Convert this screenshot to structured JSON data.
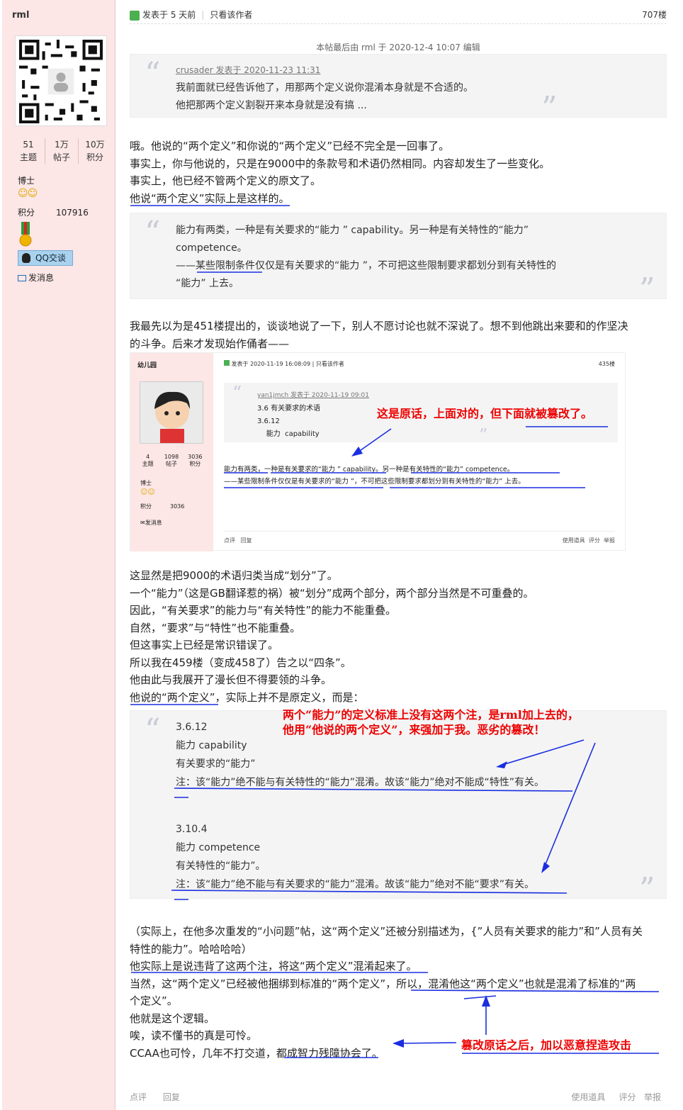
{
  "user": {
    "name": "rml",
    "stats": [
      {
        "num": "51",
        "label": "主题"
      },
      {
        "num": "1万",
        "label": "帖子"
      },
      {
        "num": "10万",
        "label": "积分"
      }
    ],
    "rank": "博士",
    "points_label": "积分",
    "points_value": "107916",
    "qq_label": "QQ交谈",
    "msg_label": "发消息"
  },
  "post": {
    "posted": "发表于 5 天前",
    "only_author": "只看该作者",
    "floor": "707楼",
    "edited": "本帖最后由 rml 于 2020-12-4 10:07 编辑"
  },
  "quote1": {
    "head": "crusader 发表于 2020-11-23 11:31",
    "lines": [
      "我前面就已经告诉他了，用那两个定义说你混淆本身就是不合适的。",
      "他把那两个定义割裂开来本身就是没有搞 ..."
    ]
  },
  "para1": [
    "哦。他说的“两个定义”和你说的“两个定义”已经不完全是一回事了。",
    "事实上，你与他说的，只是在9000中的条款号和术语仍然相同。内容却发生了一些变化。",
    "事实上，他已经不管两个定义的原文了。",
    "他说“两个定义”实际上是这样的。"
  ],
  "quote2": {
    "lines": [
      "能力有两类，一种是有关要求的“能力 ” capability。另一种是有关特性的“能力”",
      "competence。",
      "——某些限制条件仅仅是有关要求的“能力 ”，不可把这些限制要求都划分到有关特性的",
      "“能力” 上去。"
    ]
  },
  "para2": [
    "我最先以为是451楼提出的，谈谈地说了一下，别人不愿讨论也就不深说了。想不到他跳出来要和的作坚决",
    "的斗争。后来才发现始作俑者——"
  ],
  "shot": {
    "user": "幼儿园",
    "posted": "发表于 2020-11-19 16:08:09",
    "only_author": "只看该作者",
    "floor": "435楼",
    "stats": [
      {
        "num": "4",
        "label": "主题"
      },
      {
        "num": "1098",
        "label": "帖子"
      },
      {
        "num": "3036",
        "label": "积分"
      }
    ],
    "rank": "博士",
    "points_label": "积分",
    "points_value": "3036",
    "msg": "发消息",
    "quote_head": "yan1jmch 发表于 2020-11-19 09:01",
    "quote_lines": [
      "3.6  有关要求的术语",
      "3.6.12",
      "    能力  capability"
    ],
    "body": [
      "能力有两类，一种是有关要求的“能力 ” capability。另一种是有关特性的“能力” competence。",
      "——某些限制条件仅仅是有关要求的“能力 ”，不可把这些限制要求都划分到有关特性的“能力” 上去。"
    ],
    "annotation": "这是原话，上面对的，但下面就被篡改了。",
    "actions": [
      "点评",
      "回复"
    ],
    "right_actions": [
      "使用道具",
      "评分",
      "举报"
    ]
  },
  "para3": [
    "这显然是把9000的术语归类当成“划分”了。",
    "一个“能力”（这是GB翻译惹的祸）被“划分”成两个部分，两个部分当然是不可重叠的。",
    "因此，“有关要求”的能力与“有关特性”的能力不能重叠。",
    "自然，“要求”与“特性”也不能重叠。",
    "但这事实上已经是常识错误了。",
    "所以我在459楼（变成458了）告之以“四条”。",
    "他由此与我展开了漫长但不得要领的斗争。",
    "他说的“两个定义”，实际上并不是原定义，而是："
  ],
  "quote3": {
    "annotation": [
      "两个“能力”的定义标准上没有这两个注，是rml加上去的，",
      "他用“他说的两个定义”，来强加于我。恶劣的篡改！"
    ],
    "lines": [
      "3.6.12",
      "能力 capability",
      "有关要求的“能力”",
      "注：该“能力”绝不能与有关特性的“能力”混淆。故该“能力”绝对不能成“特性”有关。",
      "",
      "3.10.4",
      "能力 competence",
      "有关特性的“能力”。",
      "注：该“能力”绝不能与有关要求的“能力”混淆。故该“能力”绝对不能“要求”有关。"
    ]
  },
  "para4": [
    "（实际上，在他多次重发的“小问题”帖，这“两个定义”还被分别描述为，{”人员有关要求的能力”和”人员有关",
    "特性的能力”。哈哈哈哈）",
    "他实际上是说违背了这两个注，将这“两个定义”混淆起来了。",
    "当然，这“两个定义”已经被他捆绑到标准的“两个定义”，所以，混淆他这“两个定义”也就是混淆了标准的“两",
    "个定义”。",
    "他就是这个逻辑。",
    "唉，读不懂书的真是可怜。",
    "CCAA也可怜，几年不打交道，都成智力残障协会了。"
  ],
  "annotation2": "篡改原话之后，加以恶意捏造攻击",
  "footer": {
    "left": [
      "点评",
      "回复"
    ],
    "right": [
      "使用道具",
      "评分",
      "举报"
    ]
  }
}
